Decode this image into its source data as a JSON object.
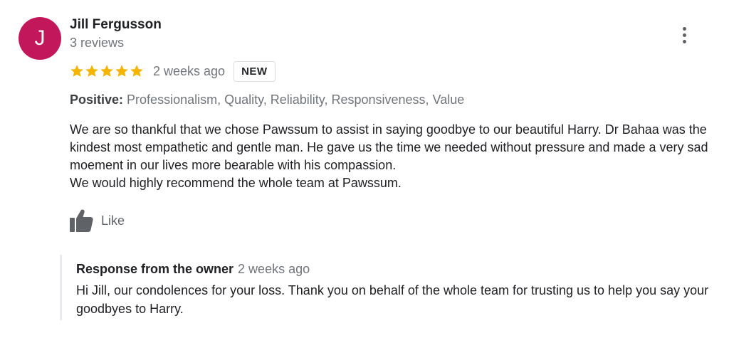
{
  "review": {
    "reviewer_name": "Jill Fergusson",
    "avatar_initial": "J",
    "review_count": "3 reviews",
    "rating": 5,
    "rating_max": 5,
    "time": "2 weeks ago",
    "badge": "NEW",
    "positive_label": "Positive:",
    "positive_attributes": "Professionalism, Quality, Reliability, Responsiveness, Value",
    "text_paragraph_1": "We are so thankful that we chose Pawssum to assist in saying goodbye to our beautiful Harry. Dr Bahaa was the kindest most empathetic and gentle man. He gave us the time we needed without pressure and made a very sad moement in our lives more bearable with his compassion.",
    "text_paragraph_2": "We would highly recommend the whole team at Pawssum.",
    "like_label": "Like"
  },
  "owner_response": {
    "label": "Response from the owner",
    "time": "2 weeks ago",
    "text": "Hi Jill, our condolences for your loss. Thank you on behalf of the whole team for trusting us to help you say your goodbyes to Harry."
  },
  "icons": {
    "more": "more-vert-icon",
    "star": "star-icon",
    "like": "thumbs-up-icon"
  },
  "colors": {
    "avatar_bg": "#c2185b",
    "star": "#f4b400",
    "muted_text": "#70757a"
  }
}
